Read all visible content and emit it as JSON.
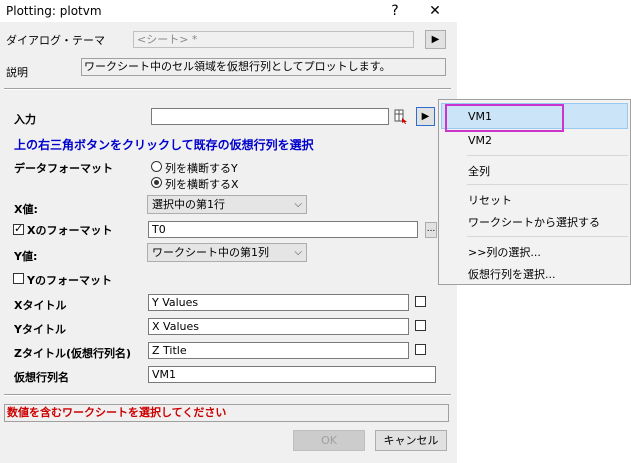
{
  "window": {
    "title": "Plotting: plotvm",
    "help_glyph": "?",
    "close_glyph": "✕"
  },
  "theme": {
    "label": "ダイアログ・テーマ",
    "value": "<シート> *",
    "arrow": "▶"
  },
  "description": {
    "label": "説明",
    "text": "ワークシート中のセル領域を仮想行列としてプロットします。"
  },
  "input": {
    "label": "入力",
    "value": "",
    "arrow": "▶",
    "hint": "上の右三角ボタンをクリックして既存の仮想行列を選択"
  },
  "data_format": {
    "label": "データフォーマット",
    "options": [
      "列を横断するY",
      "列を横断するX"
    ],
    "selected_index": 1
  },
  "x_value": {
    "label": "X値:",
    "value": "選択中の第1行"
  },
  "x_format": {
    "label": "Xのフォーマット",
    "checked": true,
    "value": "T0",
    "browse": "..."
  },
  "y_value": {
    "label": "Y値:",
    "value": "ワークシート中の第1列"
  },
  "y_format": {
    "label": "Yのフォーマット",
    "checked": false
  },
  "x_title": {
    "label": "Xタイトル",
    "value": "Y Values",
    "checked": false
  },
  "y_title": {
    "label": "Yタイトル",
    "value": "X Values",
    "checked": false
  },
  "z_title": {
    "label": "Zタイトル(仮想行列名)",
    "value": "Z Title",
    "checked": false
  },
  "vm_name": {
    "label": "仮想行列名",
    "value": "VM1"
  },
  "status": {
    "message": "数値を含むワークシートを選択してください",
    "color": "#cc0000"
  },
  "buttons": {
    "ok": "OK",
    "cancel": "キャンセル"
  },
  "menu": {
    "items": [
      "VM1",
      "VM2",
      "全列",
      "リセット",
      "ワークシートから選択する",
      ">>列の選択...",
      "仮想行列を選択..."
    ],
    "highlight_color": "#cc33cc"
  },
  "colors": {
    "hint_blue": "#0000cc"
  }
}
